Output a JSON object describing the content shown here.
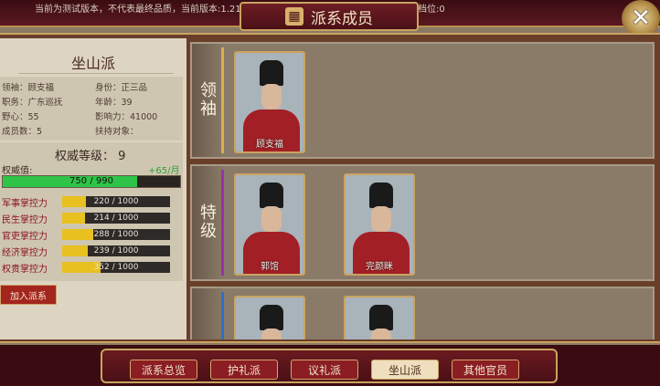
{
  "header": {
    "version_text": "当前为测试版本，不代表最终品质，当前版本:1.21.0125.2.11448，创建版本:1.21.0125.2, 档位:0",
    "title": "派系成员",
    "title_icon": "grid-icon",
    "close_symbol": "✕"
  },
  "faction": {
    "name": "坐山派",
    "info": [
      {
        "text": "领袖：顾支福"
      },
      {
        "text": "身份：正三品"
      },
      {
        "text": "职务：广东巡抚"
      },
      {
        "text": "年龄：39"
      },
      {
        "text": "野心：55"
      },
      {
        "text": "影响力：41000"
      },
      {
        "text": "成员数：5"
      },
      {
        "text": "扶持对象："
      }
    ],
    "authority": {
      "title": "权威等级：",
      "level": "9",
      "label": "权威值:",
      "rate": "+65/月",
      "value_text": "750 / 990",
      "fraction": 0.7576
    },
    "controls": [
      {
        "label": "军事掌控力",
        "value_text": "220 / 1000",
        "fraction": 0.22
      },
      {
        "label": "民生掌控力",
        "value_text": "214 / 1000",
        "fraction": 0.214
      },
      {
        "label": "官吏掌控力",
        "value_text": "288 / 1000",
        "fraction": 0.288
      },
      {
        "label": "经济掌控力",
        "value_text": "239 / 1000",
        "fraction": 0.239
      },
      {
        "label": "权贵掌控力",
        "value_text": "352 / 1000",
        "fraction": 0.352
      }
    ],
    "join_button": "加入派系"
  },
  "sections": [
    {
      "label": [
        "领",
        "袖"
      ],
      "accent": "#d8b050",
      "members": [
        "顾支福"
      ]
    },
    {
      "label": [
        "特",
        "级"
      ],
      "accent": "#9a2fb0",
      "members": [
        "郭馆",
        "完颜眯"
      ]
    },
    {
      "label": [
        "",
        ""
      ],
      "accent": "#2a6fd0",
      "members": [
        "",
        ""
      ]
    }
  ],
  "tabs": [
    {
      "label": "派系总览",
      "active": false
    },
    {
      "label": "护礼派",
      "active": false
    },
    {
      "label": "议礼派",
      "active": false
    },
    {
      "label": "坐山派",
      "active": true
    },
    {
      "label": "其他官员",
      "active": false
    }
  ],
  "colors": {
    "authority_fill": "#2fc448",
    "control_fill": "#e8c020",
    "accent_gold": "#c9a460",
    "dark_red": "#3a0c12"
  }
}
